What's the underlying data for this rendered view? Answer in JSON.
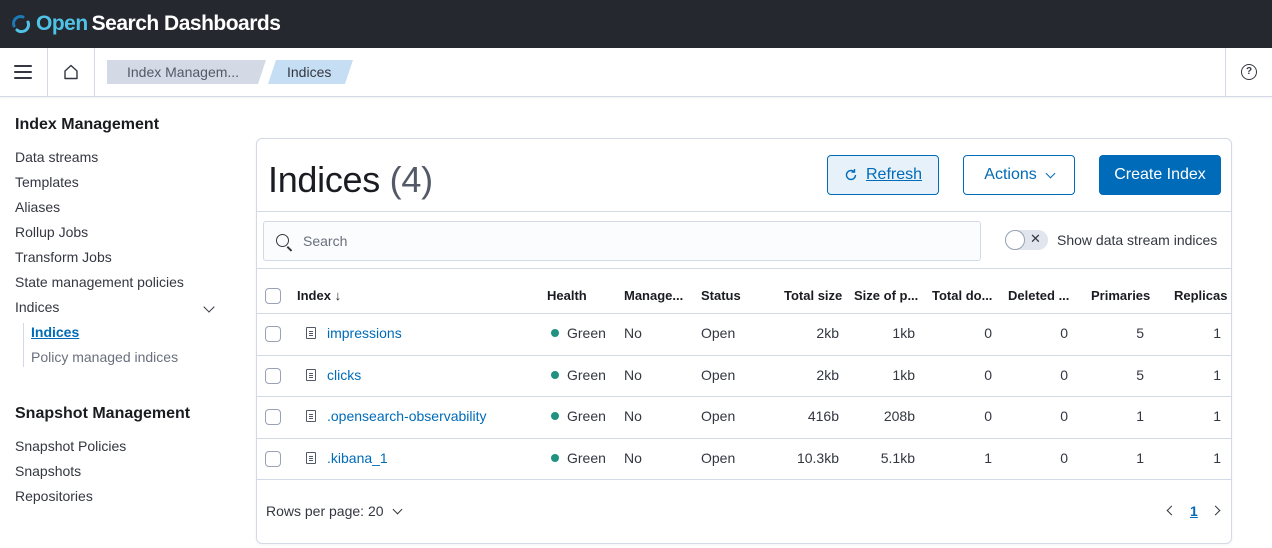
{
  "header": {
    "logo_open": "Open",
    "logo_rest": "Search Dashboards"
  },
  "breadcrumbs": [
    "Index Managem...",
    "Indices"
  ],
  "sidebar": {
    "section1_title": "Index Management",
    "items": [
      "Data streams",
      "Templates",
      "Aliases",
      "Rollup Jobs",
      "Transform Jobs",
      "State management policies",
      "Indices"
    ],
    "sub_items": [
      "Indices",
      "Policy managed indices"
    ],
    "section2_title": "Snapshot Management",
    "items2": [
      "Snapshot Policies",
      "Snapshots",
      "Repositories"
    ]
  },
  "panel": {
    "title": "Indices",
    "count": "(4)",
    "refresh_label": "Refresh",
    "actions_label": "Actions",
    "create_label": "Create Index",
    "search_placeholder": "Search",
    "toggle_label": "Show data stream indices"
  },
  "table": {
    "headers": [
      "Index",
      "Health",
      "Manage...",
      "Status",
      "Total size",
      "Size of p...",
      "Total do...",
      "Deleted ...",
      "Primaries",
      "Replicas"
    ],
    "sort_icon": "arrow-down-icon",
    "rows": [
      {
        "index": "impressions",
        "health": "Green",
        "managed": "No",
        "status": "Open",
        "total_size": "2kb",
        "size_primaries": "1kb",
        "total_docs": "0",
        "deleted": "0",
        "primaries": "5",
        "replicas": "1"
      },
      {
        "index": "clicks",
        "health": "Green",
        "managed": "No",
        "status": "Open",
        "total_size": "2kb",
        "size_primaries": "1kb",
        "total_docs": "0",
        "deleted": "0",
        "primaries": "5",
        "replicas": "1"
      },
      {
        "index": ".opensearch-observability",
        "health": "Green",
        "managed": "No",
        "status": "Open",
        "total_size": "416b",
        "size_primaries": "208b",
        "total_docs": "0",
        "deleted": "0",
        "primaries": "1",
        "replicas": "1"
      },
      {
        "index": ".kibana_1",
        "health": "Green",
        "managed": "No",
        "status": "Open",
        "total_size": "10.3kb",
        "size_primaries": "5.1kb",
        "total_docs": "1",
        "deleted": "0",
        "primaries": "1",
        "replicas": "1"
      }
    ]
  },
  "pagination": {
    "rows_per_page": "Rows per page: 20",
    "current_page": "1"
  },
  "colors": {
    "accent": "#006bb8",
    "health_green": "#209280",
    "header_bg": "#25282f"
  }
}
